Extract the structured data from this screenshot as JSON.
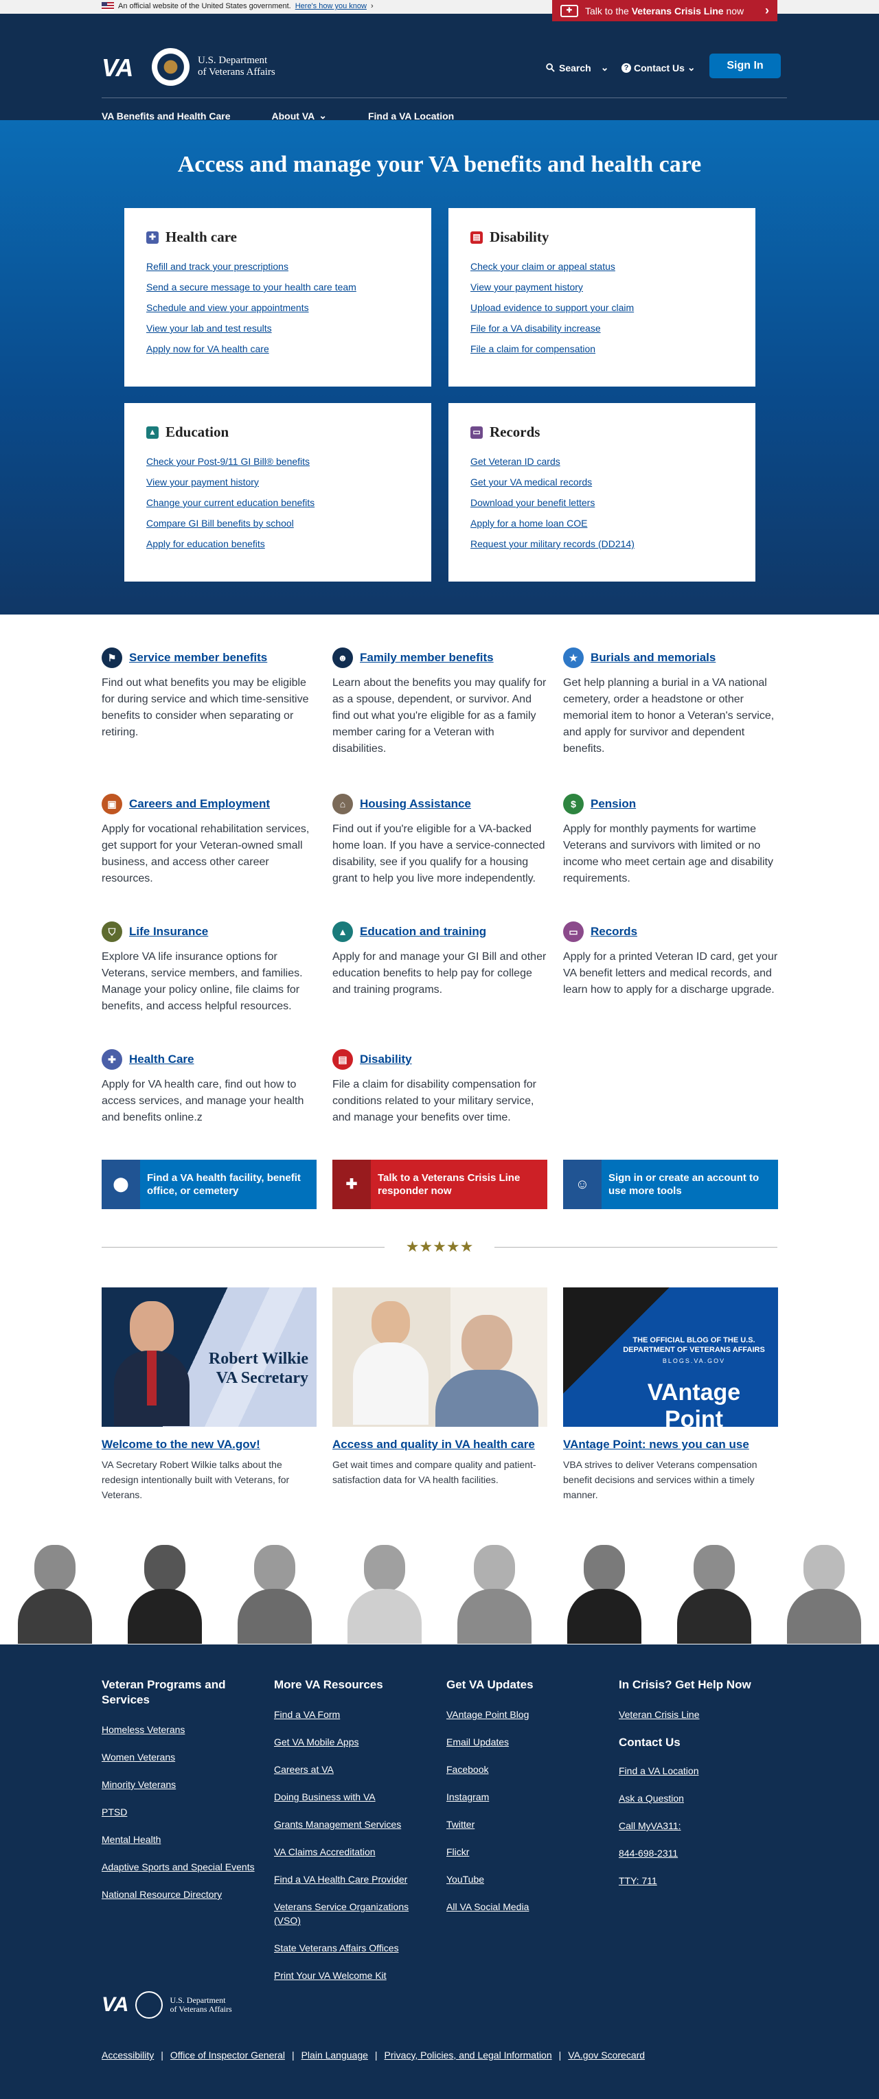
{
  "banner": {
    "official_text": "An official website of the United States government.",
    "how_link": "Here's how you know",
    "crisis_prefix": "Talk to the",
    "crisis_bold": "Veterans Crisis Line",
    "crisis_suffix": "now"
  },
  "header": {
    "logo": "VA",
    "dept_line1": "U.S. Department",
    "dept_line2": "of Veterans Affairs",
    "search": "Search",
    "contact": "Contact Us",
    "signin": "Sign In",
    "nav": [
      "VA Benefits and Health Care",
      "About VA",
      "Find a VA Location"
    ]
  },
  "hero": {
    "title": "Access and manage your VA benefits and health care",
    "hubs": [
      {
        "title": "Health care",
        "color": "#4a5fa8",
        "icon": "medkit-icon",
        "links": [
          "Refill and track your prescriptions",
          "Send a secure message to your health care team",
          "Schedule and view your appointments",
          "View your lab and test results",
          "Apply now for VA health care"
        ]
      },
      {
        "title": "Disability",
        "color": "#cd2026",
        "icon": "document-icon",
        "links": [
          "Check your claim or appeal status",
          "View your payment history",
          "Upload evidence to support your claim",
          "File for a VA disability increase",
          "File a claim for compensation"
        ]
      },
      {
        "title": "Education",
        "color": "#1a7b7b",
        "icon": "graduation-cap-icon",
        "links": [
          "Check your Post-9/11 GI Bill® benefits",
          "View your payment history",
          "Change your current education benefits",
          "Compare GI Bill benefits by school",
          "Apply for education benefits"
        ]
      },
      {
        "title": "Records",
        "color": "#6f4a8b",
        "icon": "id-card-icon",
        "links": [
          "Get Veteran ID cards",
          "Get your VA medical records",
          "Download your benefit letters",
          "Apply for a home loan COE",
          "Request your military records (DD214)"
        ]
      }
    ]
  },
  "benefits": [
    {
      "title": "Service member benefits",
      "color": "#112e51",
      "icon": "flag-icon",
      "text": "Find out what benefits you may be eligible for during service and which time-sensitive benefits to consider when separating or retiring."
    },
    {
      "title": "Family member benefits",
      "color": "#112e51",
      "icon": "family-icon",
      "text": "Learn about the benefits you may qualify for as a spouse, dependent, or survivor. And find out what you're eligible for as a family member caring for a Veteran with disabilities."
    },
    {
      "title": "Burials and memorials",
      "color": "#2e78c7",
      "icon": "star-icon",
      "text": "Get help planning a burial in a VA national cemetery, order a headstone or other memorial item to honor a Veteran's service, and apply for survivor and dependent benefits."
    },
    {
      "title": "Careers and Employment",
      "color": "#c05621",
      "icon": "briefcase-icon",
      "text": "Apply for vocational rehabilitation services, get support for your Veteran-owned small business, and access other career resources."
    },
    {
      "title": "Housing Assistance",
      "color": "#7b6a58",
      "icon": "home-icon",
      "text": "Find out if you're eligible for a VA-backed home loan. If you have a service-connected disability, see if you qualify for a housing grant to help you live more independently."
    },
    {
      "title": "Pension",
      "color": "#2e8540",
      "icon": "money-icon",
      "text": "Apply for monthly payments for wartime Veterans and survivors with limited or no income who meet certain age and disability requirements."
    },
    {
      "title": "Life Insurance",
      "color": "#5e6b2f",
      "icon": "shield-icon",
      "text": "Explore VA life insurance options for Veterans, service members, and families. Manage your policy online, file claims for benefits, and access helpful resources."
    },
    {
      "title": "Education and training",
      "color": "#1a7b7b",
      "icon": "graduation-cap-icon",
      "text": "Apply for and manage your GI Bill and other education benefits to help pay for college and training programs."
    },
    {
      "title": "Records",
      "color": "#8b4a8b",
      "icon": "id-card-icon",
      "text": "Apply for a printed Veteran ID card, get your VA benefit letters and medical records, and learn how to apply for a discharge upgrade."
    },
    {
      "title": "Health Care",
      "color": "#4a5fa8",
      "icon": "medkit-icon",
      "text": "Apply for VA health care, find out how to access services, and manage your health and benefits online.z"
    },
    {
      "title": "Disability",
      "color": "#cd2026",
      "icon": "document-icon",
      "text": "File a claim for disability compensation for conditions related to your military service, and manage your benefits over time."
    }
  ],
  "cta": [
    {
      "text": "Find a VA health facility, benefit office, or cemetery",
      "bg": "#0071bc",
      "iconbg": "#205493",
      "icon": "map-pin-icon"
    },
    {
      "text": "Talk to a Veterans Crisis Line responder now",
      "bg": "#cd2026",
      "iconbg": "#981b1e",
      "icon": "crisis-chat-icon"
    },
    {
      "text": "Sign in or create an account to use more tools",
      "bg": "#0071bc",
      "iconbg": "#205493",
      "icon": "user-circle-icon"
    }
  ],
  "news": [
    {
      "title": "Welcome to the new VA.gov!",
      "text": "VA Secretary Robert Wilkie talks about the redesign intentionally built with Veterans, for Veterans.",
      "img_line1": "Robert Wilkie",
      "img_line2": "VA Secretary"
    },
    {
      "title": "Access and quality in VA health care",
      "text": "Get wait times and compare quality and patient-satisfaction data for VA health facilities."
    },
    {
      "title": "VAntage Point: news you can use",
      "text": "VBA strives to deliver Veterans compensation benefit decisions and services within a timely manner.",
      "img_line1": "THE OFFICIAL BLOG OF THE U.S. DEPARTMENT OF VETERANS AFFAIRS",
      "img_line2": "BLOGS.VA.GOV",
      "img_line3": "VAntage Point"
    }
  ],
  "footer": {
    "columns": [
      {
        "title": "Veteran Programs and Services",
        "links": [
          "Homeless Veterans",
          "Women Veterans",
          "Minority Veterans",
          "PTSD",
          "Mental Health",
          "Adaptive Sports and Special Events",
          "National Resource Directory"
        ]
      },
      {
        "title": "More VA Resources",
        "links": [
          "Find a VA Form",
          "Get VA Mobile Apps",
          "Careers at VA",
          "Doing Business with VA",
          "Grants Management Services",
          "VA Claims Accreditation",
          "Find a VA Health Care Provider",
          "Veterans Service Organizations (VSO)",
          "State Veterans Affairs Offices",
          "Print Your VA Welcome Kit"
        ]
      },
      {
        "title": "Get VA Updates",
        "links": [
          "VAntage Point Blog",
          "Email Updates",
          "Facebook",
          "Instagram",
          "Twitter",
          "Flickr",
          "YouTube",
          "All VA Social Media"
        ]
      },
      {
        "title": "In Crisis? Get Help Now",
        "links": [
          "Veteran Crisis Line"
        ],
        "sub_title": "Contact Us",
        "sub_links": [
          "Find a VA Location",
          "Ask a Question",
          "Call MyVA311:",
          "844-698-2311",
          "TTY: 711"
        ]
      }
    ],
    "bottom_links": [
      "Accessibility",
      "Office of Inspector General",
      "Plain Language",
      "Privacy, Policies, and Legal Information",
      "VA.gov Scorecard"
    ]
  }
}
